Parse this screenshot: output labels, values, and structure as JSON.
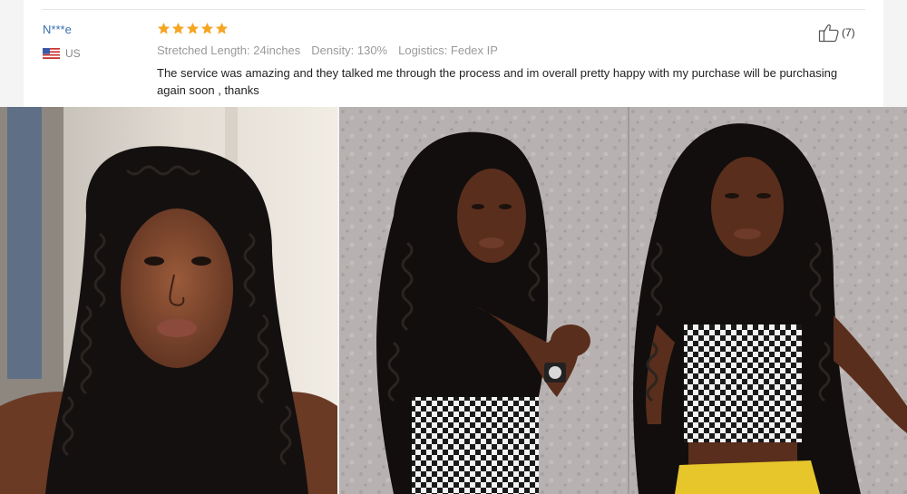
{
  "review": {
    "reviewer_name": "N***e",
    "country": "US",
    "country_flag_icon": "us-flag-icon",
    "rating": 5,
    "star_color": "#f5a623",
    "specs": [
      "Stretched Length: 24inches",
      "Density: 130%",
      "Logistics: Fedex IP"
    ],
    "text": "The service was amazing and they talked me through the process and im overall pretty happy with my purchase will be purchasing again soon , thanks",
    "helpful_icon": "thumbs-up-icon",
    "helpful_count": "(7)"
  },
  "photos": [
    {
      "kind": "selfie",
      "icon": "review-photo-selfie"
    },
    {
      "kind": "two-pose",
      "icon": "review-photo-poses"
    }
  ]
}
